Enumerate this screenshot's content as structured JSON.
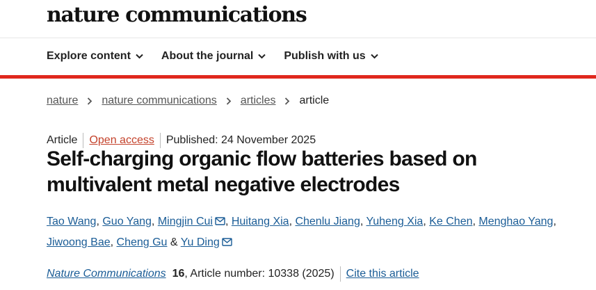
{
  "header": {
    "logo_text": "nature communications"
  },
  "nav": {
    "items": [
      {
        "label": "Explore content",
        "icon": "chevron-down-icon"
      },
      {
        "label": "About the journal",
        "icon": "chevron-down-icon"
      },
      {
        "label": "Publish with us",
        "icon": "chevron-down-icon"
      }
    ]
  },
  "breadcrumb": {
    "items": [
      "nature",
      "nature communications",
      "articles"
    ],
    "current": "article"
  },
  "article": {
    "type": "Article",
    "access": "Open access",
    "published": "Published: 24 November 2025",
    "title": "Self-charging organic flow batteries based on multivalent metal negative electrodes",
    "authors": [
      {
        "name": "Tao Wang"
      },
      {
        "name": "Guo Yang"
      },
      {
        "name": "Mingjin Cui",
        "corresponding": true
      },
      {
        "name": "Huitang Xia"
      },
      {
        "name": "Chenlu Jiang"
      },
      {
        "name": "Yuheng Xia"
      },
      {
        "name": "Ke Chen"
      },
      {
        "name": "Menghao Yang"
      },
      {
        "name": "Jiwoong Bae"
      },
      {
        "name": "Cheng Gu"
      },
      {
        "name": "Yu Ding",
        "corresponding": true
      }
    ],
    "journal": "Nature Communications",
    "volume": "16",
    "article_number": ", Article number: 10338 (2025)",
    "cite_label": "Cite this article"
  },
  "colors": {
    "accent_red": "#e0281e",
    "link_blue": "#1a5c96",
    "open_access": "#c4422b"
  }
}
